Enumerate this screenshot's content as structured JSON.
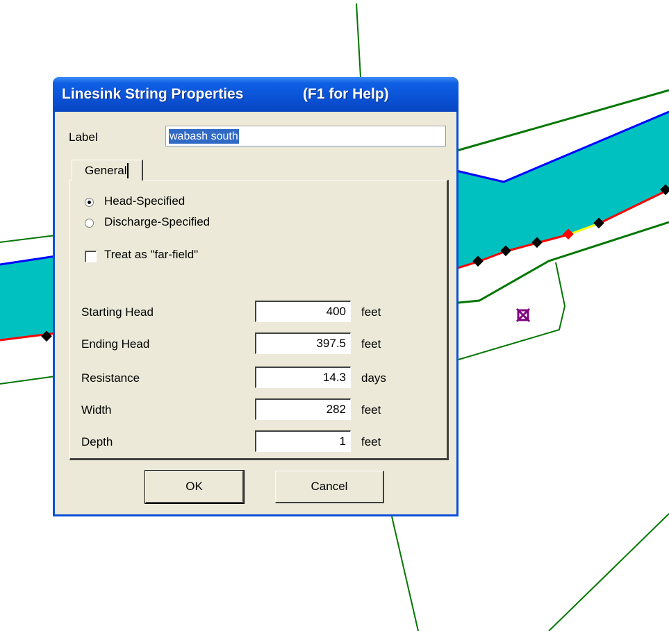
{
  "dialog": {
    "title": "Linesink String Properties",
    "help_hint": "(F1 for Help)",
    "label_caption": "Label",
    "label_value": "wabash south",
    "tab": "General",
    "mode_options": [
      {
        "label": "Head-Specified",
        "selected": true
      },
      {
        "label": "Discharge-Specified",
        "selected": false
      }
    ],
    "far_field": {
      "label": "Treat as \"far-field\"",
      "checked": false
    },
    "fields": [
      {
        "label": "Starting Head",
        "value": "400",
        "unit": "feet"
      },
      {
        "label": "Ending Head",
        "value": "397.5",
        "unit": "feet"
      },
      {
        "label": "Resistance",
        "value": "14.3",
        "unit": "days"
      },
      {
        "label": "Width",
        "value": "282",
        "unit": "feet"
      },
      {
        "label": "Depth",
        "value": "1",
        "unit": "feet"
      }
    ],
    "ok_label": "OK",
    "cancel_label": "Cancel"
  },
  "colors": {
    "river_fill": "#00c0c0",
    "boundary_blue": "#0000ff",
    "linesink_red": "#ff0000",
    "highlight_yellow": "#ffff00",
    "outline_green": "#007700",
    "well_marker": "#800080"
  },
  "map": {
    "well_marker_icon": "well-x-marker-icon"
  }
}
